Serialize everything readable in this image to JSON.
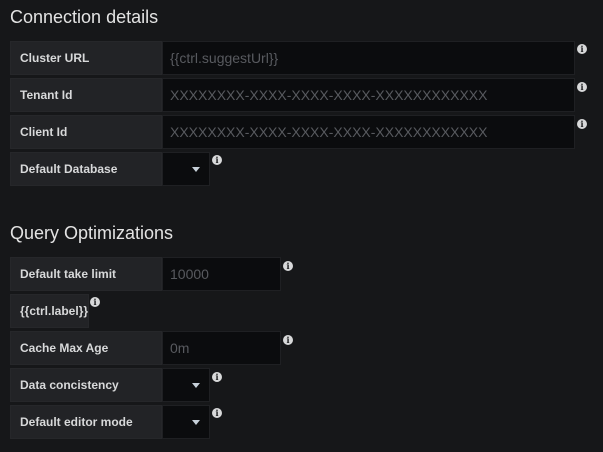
{
  "connection": {
    "title": "Connection details",
    "cluster_url": {
      "label": "Cluster URL",
      "placeholder": "{{ctrl.suggestUrl}}"
    },
    "tenant_id": {
      "label": "Tenant Id",
      "placeholder": "XXXXXXXX-XXXX-XXXX-XXXX-XXXXXXXXXXXX"
    },
    "client_id": {
      "label": "Client Id",
      "placeholder": "XXXXXXXX-XXXX-XXXX-XXXX-XXXXXXXXXXXX"
    },
    "default_database": {
      "label": "Default Database",
      "value": ""
    }
  },
  "query": {
    "title": "Query Optimizations",
    "take_limit": {
      "label": "Default take limit",
      "placeholder": "10000"
    },
    "ctrl_label": {
      "label": "{{ctrl.label}}"
    },
    "cache_max_age": {
      "label": "Cache Max Age",
      "placeholder": "0m"
    },
    "data_consistency": {
      "label": "Data concistency",
      "value": ""
    },
    "editor_mode": {
      "label": "Default editor mode",
      "value": ""
    }
  },
  "icons": {
    "info": "info-circle-icon",
    "dropdown": "caret-down-icon",
    "info_glyph": "i"
  }
}
